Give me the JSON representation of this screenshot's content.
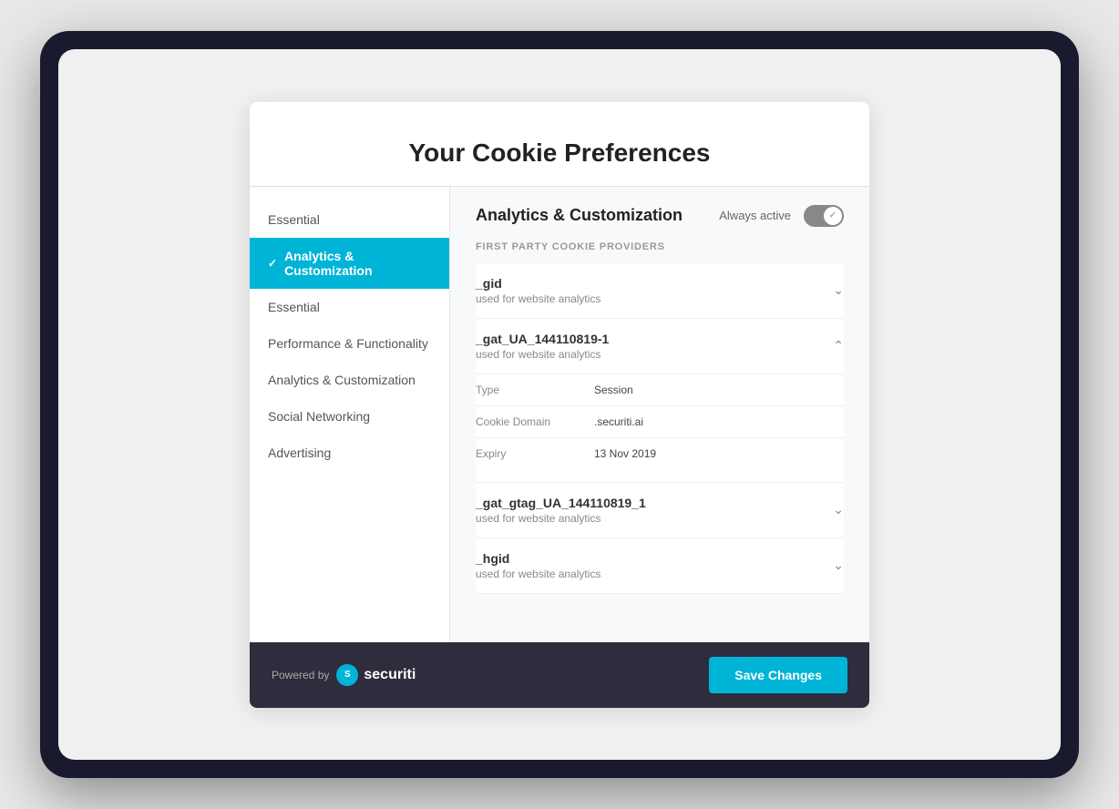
{
  "page": {
    "title": "Your Cookie Preferences"
  },
  "sidebar": {
    "items": [
      {
        "id": "essential-top",
        "label": "Essential",
        "active": false
      },
      {
        "id": "analytics-customization",
        "label": "Analytics & Customization",
        "active": true
      },
      {
        "id": "essential",
        "label": "Essential",
        "active": false
      },
      {
        "id": "performance-functionality",
        "label": "Performance & Functionality",
        "active": false
      },
      {
        "id": "analytics-customization-2",
        "label": "Analytics & Customization",
        "active": false
      },
      {
        "id": "social-networking",
        "label": "Social Networking",
        "active": false
      },
      {
        "id": "advertising",
        "label": "Advertising",
        "active": false
      }
    ]
  },
  "content": {
    "title": "Analytics & Customization",
    "always_active_label": "Always active",
    "section_label": "FIRST PARTY COOKIE PROVIDERS",
    "cookies": [
      {
        "id": "gid",
        "name": "_gid",
        "description": "used for website analytics",
        "expanded": false,
        "details": []
      },
      {
        "id": "gat-ua",
        "name": "_gat_UA_144110819-1",
        "description": "used for website analytics",
        "expanded": true,
        "details": [
          {
            "label": "Type",
            "value": "Session"
          },
          {
            "label": "Cookie Domain",
            "value": ".securiti.ai"
          },
          {
            "label": "Expiry",
            "value": "13 Nov 2019"
          }
        ]
      },
      {
        "id": "gat-gtag",
        "name": "_gat_gtag_UA_144110819_1",
        "description": "used for website analytics",
        "expanded": false,
        "details": []
      },
      {
        "id": "hgid",
        "name": "_hgid",
        "description": "used for website analytics",
        "expanded": false,
        "details": []
      }
    ]
  },
  "footer": {
    "powered_by_label": "Powered by",
    "brand_name": "securiti",
    "save_button_label": "Save Changes"
  }
}
